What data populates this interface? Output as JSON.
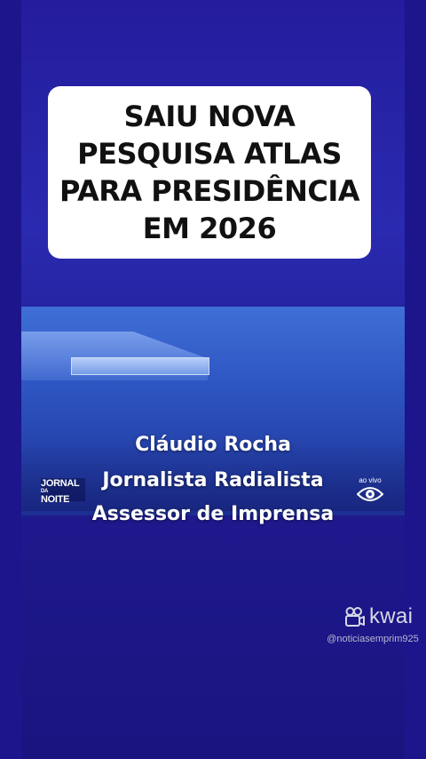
{
  "headline": {
    "lines": [
      "SAIU NOVA",
      "PESQUISA  ATLAS",
      "PARA PRESIDÊNCIA",
      "EM 2026"
    ]
  },
  "video": {
    "logo_left": [
      "JORNAL",
      "DA",
      "NOITE"
    ],
    "live_label": "ao vivo",
    "live_icon": "eye-icon"
  },
  "caption": {
    "line1": "Cláudio Rocha",
    "line2": "Jornalista Radialista",
    "line3": "Assessor de Imprensa"
  },
  "watermark": {
    "brand": "kwai",
    "brand_icon": "kwai-camera-icon",
    "handle": "@noticiasemprim925"
  },
  "colors": {
    "background": "#241c9c",
    "headline_bg": "#ffffff",
    "headline_text": "#111111"
  }
}
